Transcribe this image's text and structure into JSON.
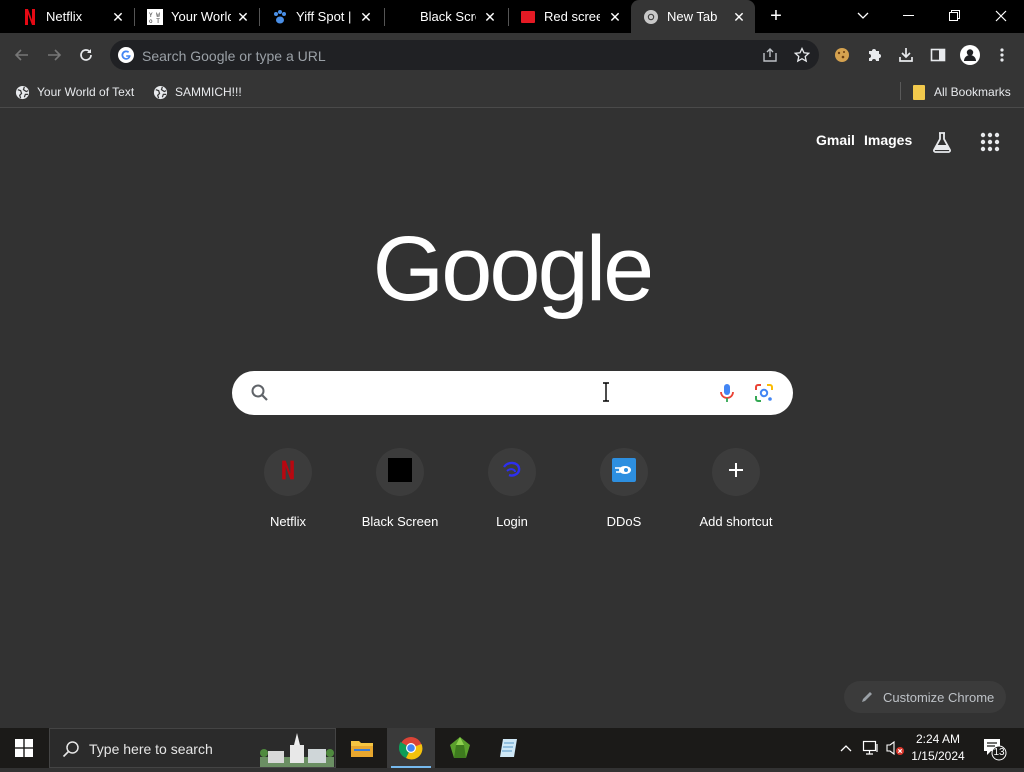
{
  "tabs": [
    {
      "title": "Netflix",
      "favicon": "netflix-icon"
    },
    {
      "title": "Your World",
      "favicon": "your-world-of-text-icon"
    },
    {
      "title": "Yiff Spot |",
      "favicon": "paw-icon"
    },
    {
      "title": "Black Scree",
      "favicon": "black-square-icon"
    },
    {
      "title": "Red screen",
      "favicon": "red-square-icon"
    },
    {
      "title": "New Tab",
      "favicon": "chrome-icon",
      "active": true
    }
  ],
  "omnibox": {
    "placeholder": "Search Google or type a URL"
  },
  "bookmarks": {
    "items": [
      {
        "label": "Your World of Text",
        "icon": "globe-icon"
      },
      {
        "label": "SAMMICH!!!",
        "icon": "globe-icon"
      }
    ],
    "all_bookmarks": "All Bookmarks"
  },
  "ntp": {
    "gmail": "Gmail",
    "images": "Images",
    "logo_text": "Google",
    "search_placeholder": "",
    "shortcuts": [
      {
        "label": "Netflix",
        "icon": "netflix-icon"
      },
      {
        "label": "Black Screen",
        "icon": "black-square-icon"
      },
      {
        "label": "Login",
        "icon": "login-swirl-icon"
      },
      {
        "label": "DDoS",
        "icon": "ddos-icon"
      },
      {
        "label": "Add shortcut",
        "icon": "plus-icon"
      }
    ],
    "customize": "Customize Chrome"
  },
  "taskbar": {
    "search_placeholder": "Type here to search",
    "time": "2:24 AM",
    "date": "1/15/2024",
    "notification_count": "13"
  },
  "colors": {
    "page_bg": "#323232",
    "tabstrip_bg": "#000000",
    "toolbar_bg": "#353535",
    "omnibox_bg": "#202124",
    "taskbar_bg": "#1b1a18"
  }
}
